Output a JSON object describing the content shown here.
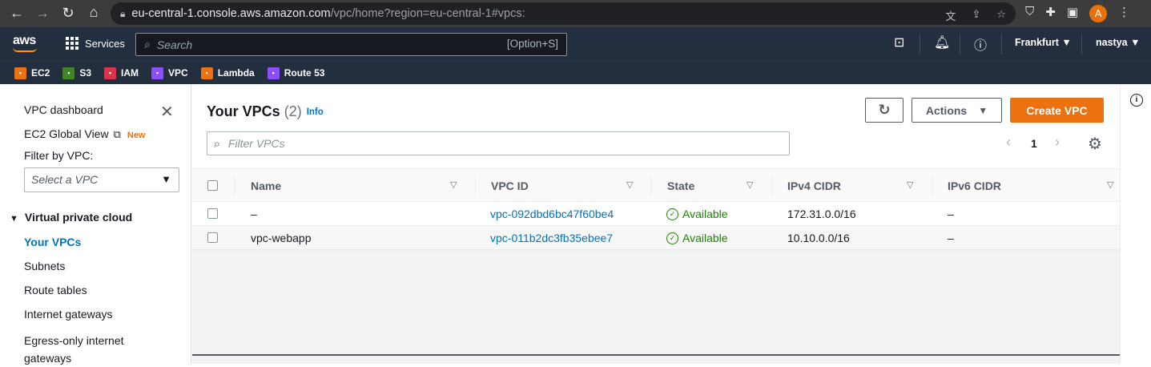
{
  "browser": {
    "url_host": "eu-central-1.console.aws.amazon.com",
    "url_path": "/vpc/home?region=eu-central-1#vpcs:",
    "avatar_letter": "A"
  },
  "aws": {
    "logo": "aws",
    "services_label": "Services",
    "search_placeholder": "Search",
    "search_shortcut": "[Option+S]",
    "region": "Frankfurt",
    "user": "nastya"
  },
  "favorites": [
    {
      "label": "EC2",
      "color": "#ec7211",
      "icon": "ec2-icon"
    },
    {
      "label": "S3",
      "color": "#3f8624",
      "icon": "s3-icon"
    },
    {
      "label": "IAM",
      "color": "#dd344c",
      "icon": "iam-icon"
    },
    {
      "label": "VPC",
      "color": "#8c4fff",
      "icon": "vpc-icon"
    },
    {
      "label": "Lambda",
      "color": "#ec7211",
      "icon": "lambda-icon"
    },
    {
      "label": "Route 53",
      "color": "#8c4fff",
      "icon": "route53-icon"
    }
  ],
  "sidebar": {
    "dashboard": "VPC dashboard",
    "global_view": "EC2 Global View",
    "new_badge": "New",
    "filter_label": "Filter by VPC:",
    "select_placeholder": "Select a VPC",
    "section": "Virtual private cloud",
    "items": [
      "Your VPCs",
      "Subnets",
      "Route tables",
      "Internet gateways",
      "Egress-only internet gateways"
    ]
  },
  "main": {
    "title": "Your VPCs",
    "count": "(2)",
    "info": "Info",
    "actions_label": "Actions",
    "create_label": "Create VPC",
    "filter_placeholder": "Filter VPCs",
    "page": "1",
    "columns": [
      "Name",
      "VPC ID",
      "State",
      "IPv4 CIDR",
      "IPv6 CIDR"
    ],
    "rows": [
      {
        "name": "–",
        "vpc_id": "vpc-092dbd6bc47f60be4",
        "state": "Available",
        "ipv4": "172.31.0.0/16",
        "ipv6": "–"
      },
      {
        "name": "vpc-webapp",
        "vpc_id": "vpc-011b2dc3fb35ebee7",
        "state": "Available",
        "ipv4": "10.10.0.0/16",
        "ipv6": "–"
      }
    ]
  }
}
